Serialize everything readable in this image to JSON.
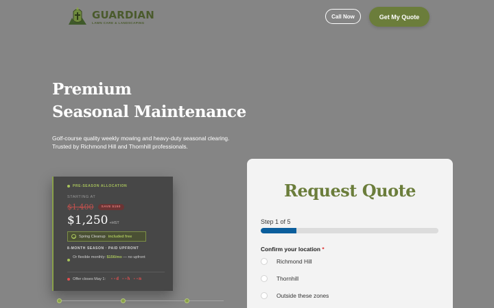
{
  "header": {
    "logo_name": "GUARDIAN",
    "logo_tagline": "LAWN CARE & LANDSCAPING",
    "call_label": "Call Now",
    "quote_label": "Get My Quote"
  },
  "hero": {
    "title_line1": "Premium",
    "title_line2": "Seasonal Maintenance",
    "subtitle": "Golf-course quality weekly mowing and heavy-duty seasonal clearing. Trusted by Richmond Hill and Thornhill professionals."
  },
  "pricing": {
    "allocation": "PRE-SEASON ALLOCATION",
    "starting_at": "STARTING AT",
    "old_price": "$1,400",
    "save_badge": "SAVE $150",
    "new_price": "$1,250",
    "tax_note": "+HST",
    "cleanup_label": "Spring Cleanup",
    "cleanup_status": "included free",
    "season_note": "8-MONTH SEASON · PAID UPFRONT",
    "flexible_prefix": "Or flexible monthly:",
    "flexible_rate": "$156/mo",
    "flexible_suffix": "— no upfront",
    "offer_label": "Offer closes May 1:",
    "countdown": "--d --h --m"
  },
  "form": {
    "title": "Request Quote",
    "step_label": "Step 1 of 5",
    "progress": 0.2,
    "location_label": "Confirm your location",
    "required_mark": "*",
    "options": [
      "Richmond Hill",
      "Thornhill",
      "Outside these zones"
    ]
  },
  "colors": {
    "brand_green": "#6b7d3b",
    "accent_green": "#a8c35c",
    "progress_blue": "#0b5e9c",
    "alert_red": "#e05050"
  }
}
